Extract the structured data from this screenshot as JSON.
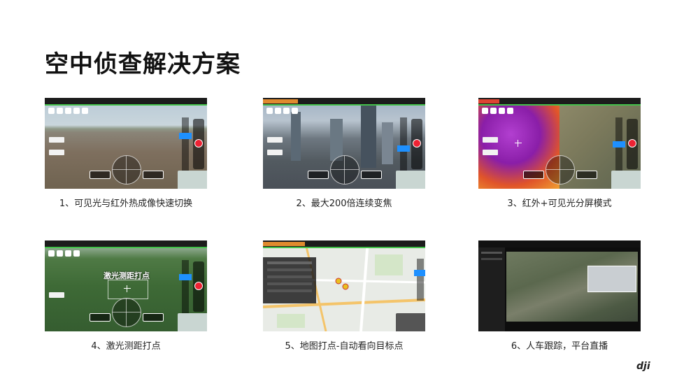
{
  "page": {
    "title": "空中侦查解决方案"
  },
  "cards": [
    {
      "caption": "1、可见光与红外热成像快速切换"
    },
    {
      "caption": "2、最大200倍连续变焦"
    },
    {
      "caption": "3、红外+可见光分屏模式"
    },
    {
      "caption": "4、激光测距打点",
      "overlay": "激光测距打点"
    },
    {
      "caption": "5、地图打点-自动看向目标点"
    },
    {
      "caption": "6、人车跟踪，平台直播"
    }
  ],
  "brand": {
    "logo": "dji"
  },
  "colors": {
    "accent_green": "#43c04a",
    "record_red": "#e22233",
    "zoom_blue": "#1e90ff"
  }
}
